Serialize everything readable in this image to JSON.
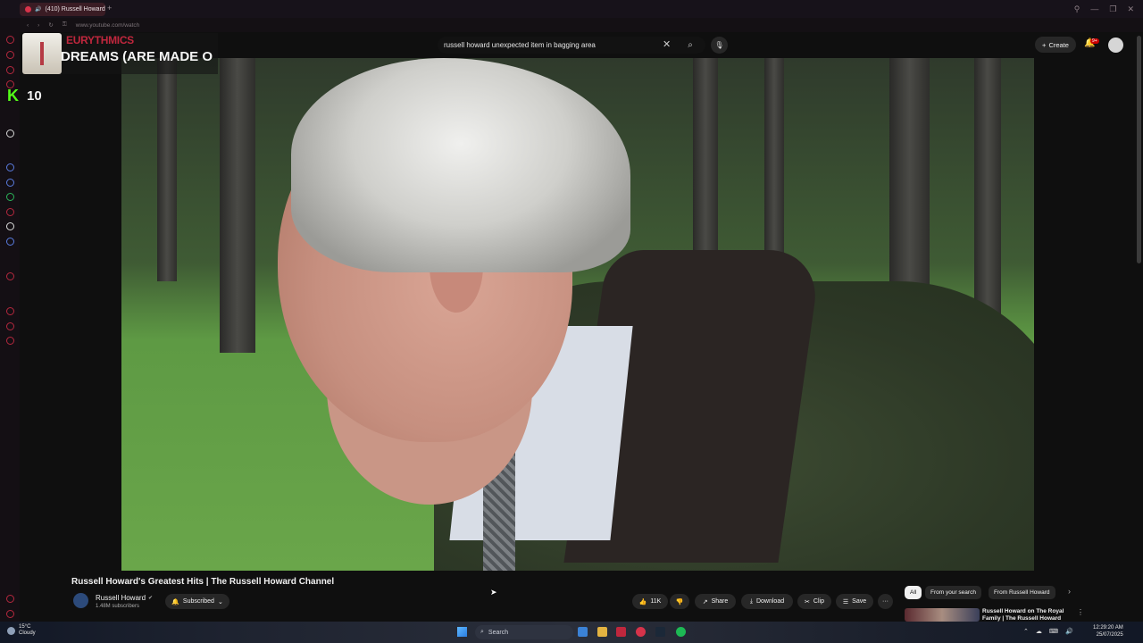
{
  "browser": {
    "tab_title": "(410) Russell Howard",
    "new_tab_glyph": "+",
    "url": "www.youtube.com/watch",
    "nav": {
      "back": "‹",
      "forward": "›",
      "reload": "↻",
      "secure": "⚿"
    },
    "window_controls": [
      "⚲",
      "—",
      "❐",
      "✕"
    ]
  },
  "now_playing": {
    "artist": "EURYTHMICS",
    "title": "DREAMS (ARE MADE O"
  },
  "kick": {
    "logo": "K",
    "count": "10"
  },
  "youtube": {
    "search_query": "russell howard unexpected item in bagging area",
    "search_clear": "✕",
    "search_icon": "⌕",
    "mic_icon": "🎙",
    "create_icon": "+",
    "create_label": "Create",
    "bell_icon": "🔔",
    "notif_badge": "9+"
  },
  "video": {
    "title": "Russell Howard's Greatest Hits | The Russell Howard Channel",
    "channel_name": "Russell Howard",
    "verified_icon": "✔",
    "subscribers": "1.48M subscribers",
    "subscribed_label": "Subscribed",
    "subscribed_icon": "🔔",
    "subscribed_caret": "⌄",
    "like_icon": "👍",
    "like_count": "11K",
    "dislike_icon": "👎",
    "share_icon": "↗",
    "share_label": "Share",
    "download_icon": "⤓",
    "download_label": "Download",
    "clip_icon": "✂",
    "clip_label": "Clip",
    "save_icon": "☰",
    "save_label": "Save",
    "more_label": "···"
  },
  "recommendations": {
    "chips": [
      "All",
      "From your search",
      "From Russell Howard"
    ],
    "next_icon": "›",
    "first_title": "Russell Howard on The Royal Family | The Russell Howard",
    "more_icon": "⋮"
  },
  "taskbar": {
    "temperature": "15°C",
    "weather": "Cloudy",
    "search_label": "Search",
    "search_icon": "⌕",
    "time": "12:29:20 AM",
    "date": "25/07/2025",
    "tray_icons": [
      "⌃",
      "☁",
      "⌨",
      "🔊"
    ]
  },
  "colors": {
    "accent_red": "#c0273d",
    "kick_green": "#53fc18",
    "yt_bg": "#0f0f0f",
    "pill_bg": "#272727"
  }
}
